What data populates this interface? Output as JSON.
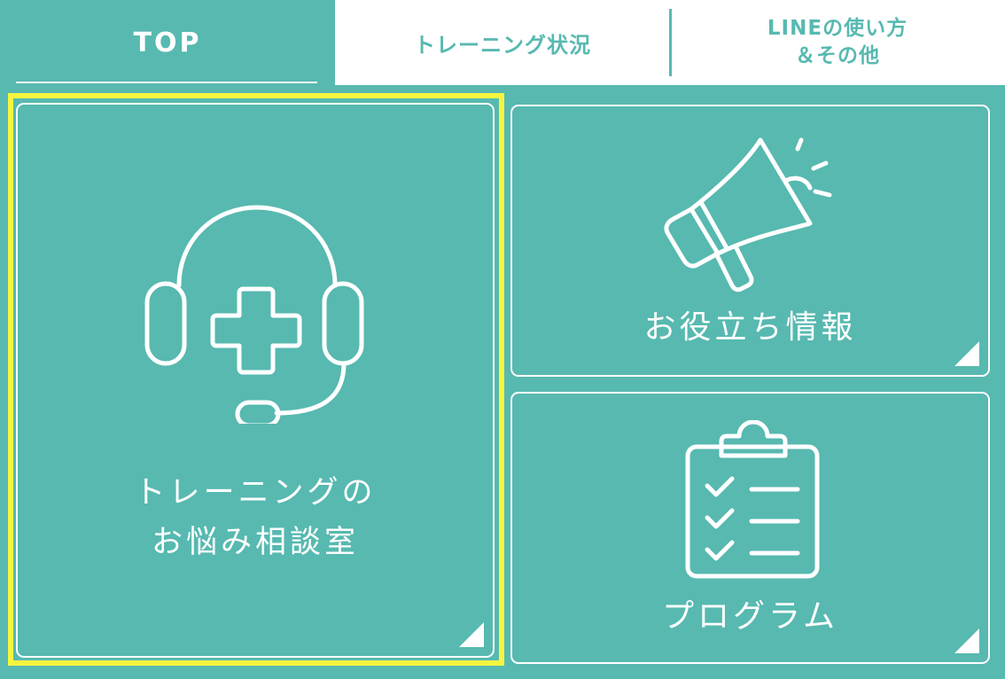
{
  "tabs": {
    "top_label": "TOP",
    "training_label": "トレーニング状況",
    "line_label_line1": "LINEの使い方",
    "line_label_line2": "＆その他"
  },
  "cards": {
    "consult_line1": "トレーニングの",
    "consult_line2": "お悩み相談室",
    "info_label": "お役立ち情報",
    "program_label": "プログラム"
  },
  "icons": {
    "consult": "headset-plus-icon",
    "info": "megaphone-icon",
    "program": "clipboard-checklist-icon",
    "corner": "corner-triangle-icon"
  },
  "colors": {
    "background": "#57b9b0",
    "tab_active_bg": "#57b9b0",
    "tab_inactive_bg": "#ffffff",
    "foreground": "#ffffff",
    "highlight": "#f6f53f"
  }
}
